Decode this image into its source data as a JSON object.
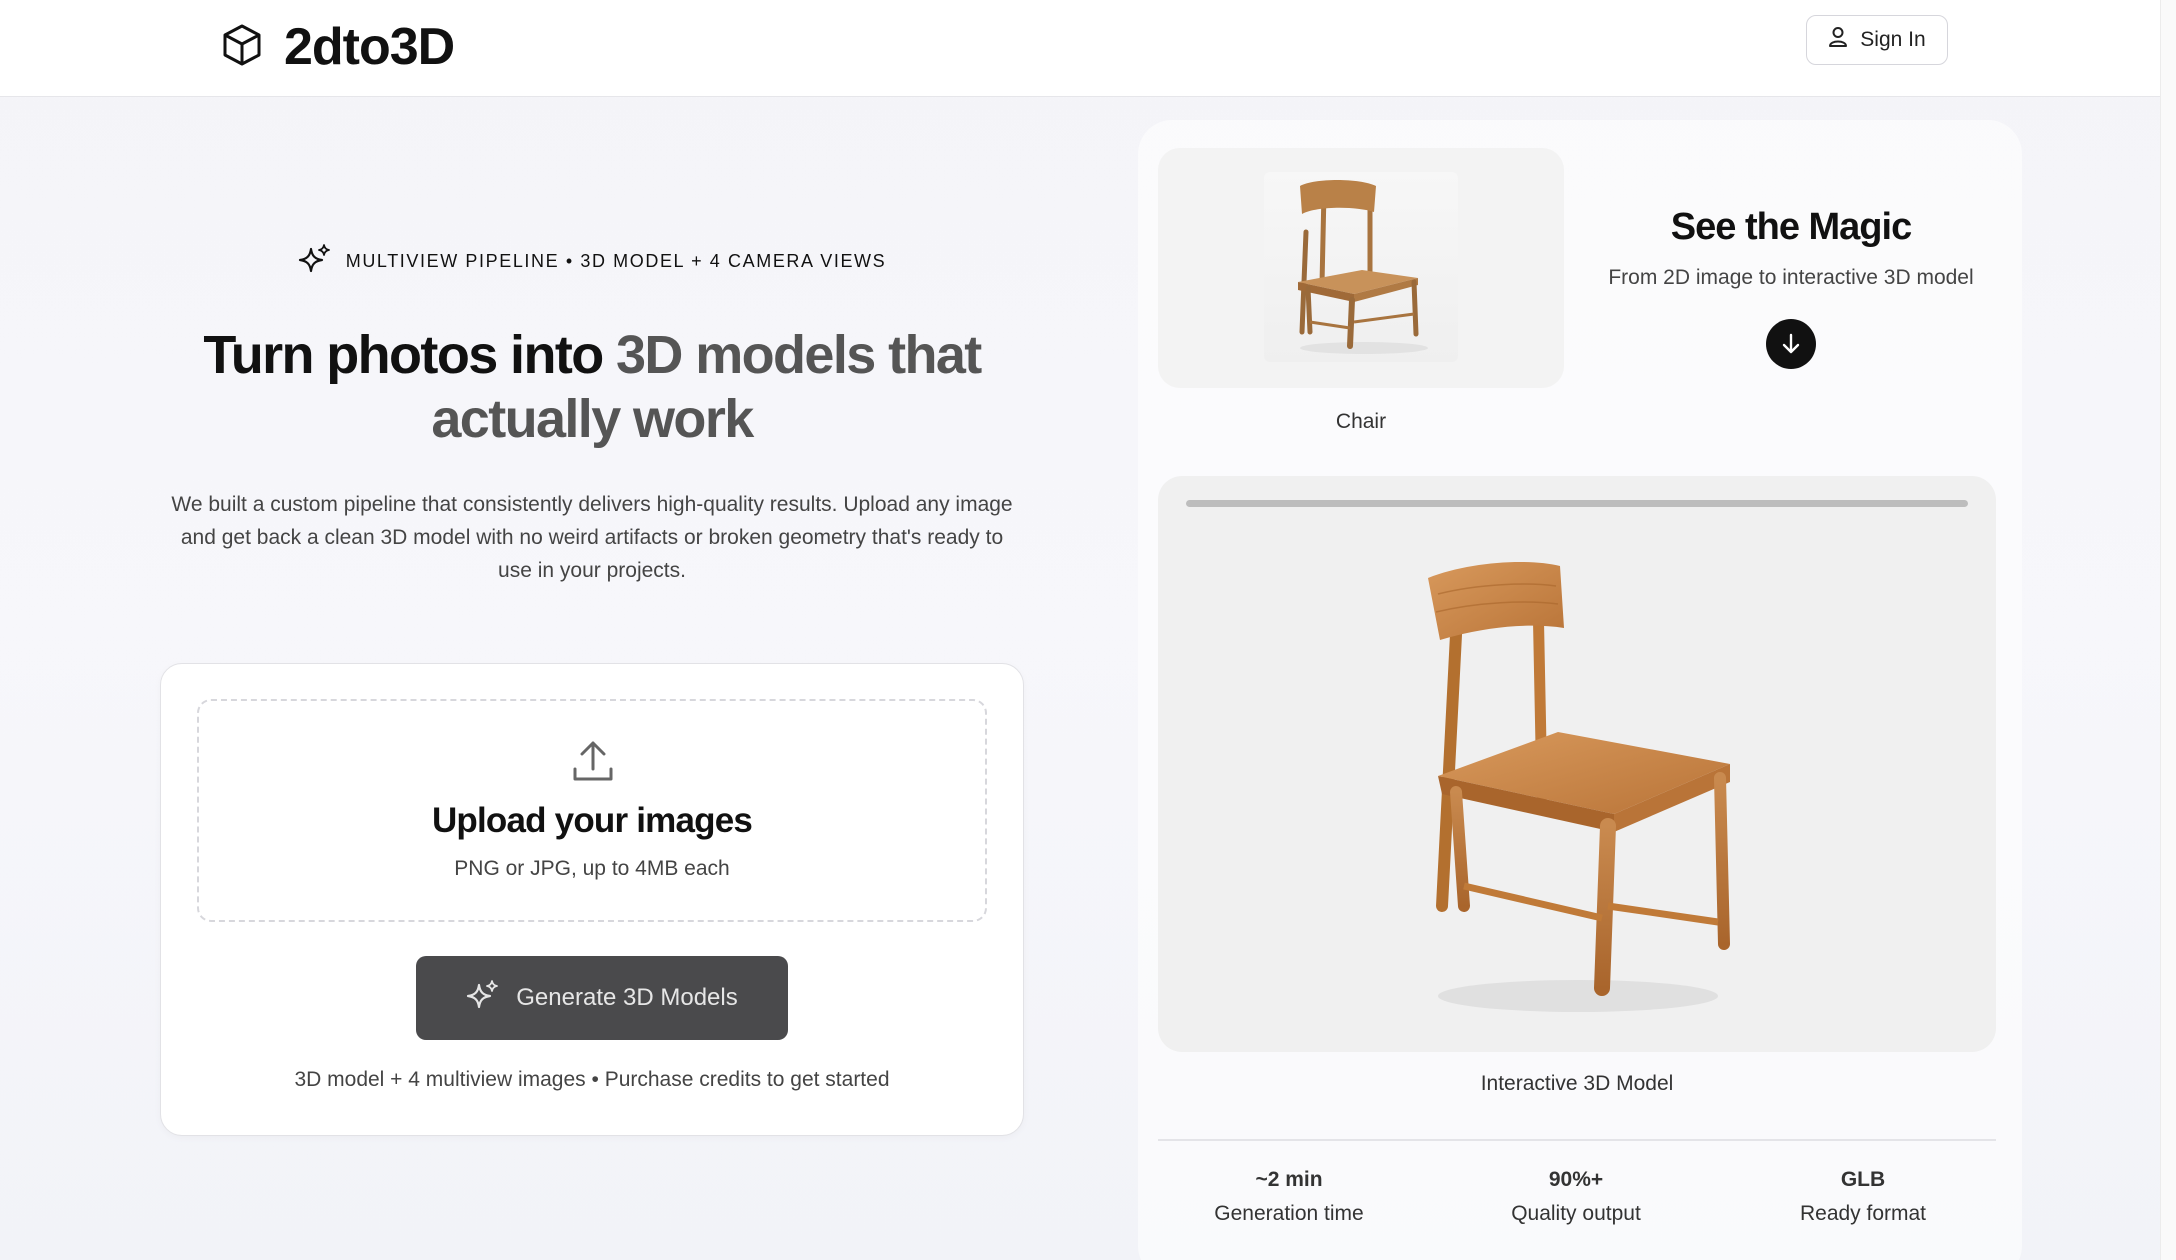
{
  "header": {
    "brand": "2dto3D",
    "logo_icon": "cube-icon",
    "signin_label": "Sign In",
    "signin_icon": "user-icon"
  },
  "hero": {
    "eyebrow": "MULTIVIEW PIPELINE • 3D MODEL + 4 CAMERA VIEWS",
    "eyebrow_icon": "sparkles-icon",
    "headline_part1": "Turn photos into ",
    "headline_part2": "3D models that actually work",
    "description": "We built a custom pipeline that consistently delivers high-quality results. Upload any image and get back a clean 3D model with no weird artifacts or broken geometry that's ready to use in your projects."
  },
  "upload": {
    "icon": "upload-icon",
    "title": "Upload your images",
    "subtitle": "PNG or JPG, up to 4MB each",
    "generate_label": "Generate 3D Models",
    "generate_icon": "sparkles-icon",
    "footnote": "3D model + 4 multiview images • Purchase credits to get started"
  },
  "demo": {
    "thumb_label": "Chair",
    "magic_title": "See the Magic",
    "magic_subtitle": "From 2D image to interactive 3D model",
    "arrow_icon": "arrow-down-icon",
    "model_label": "Interactive 3D Model",
    "model_progress": 1.0
  },
  "stats": [
    {
      "value": "~2 min",
      "label": "Generation time"
    },
    {
      "value": "90%+",
      "label": "Quality output"
    },
    {
      "value": "GLB",
      "label": "Ready format"
    }
  ],
  "colors": {
    "button_bg": "#4a4a4c",
    "accent_dark": "#111111",
    "wood": "#c98a4f"
  }
}
